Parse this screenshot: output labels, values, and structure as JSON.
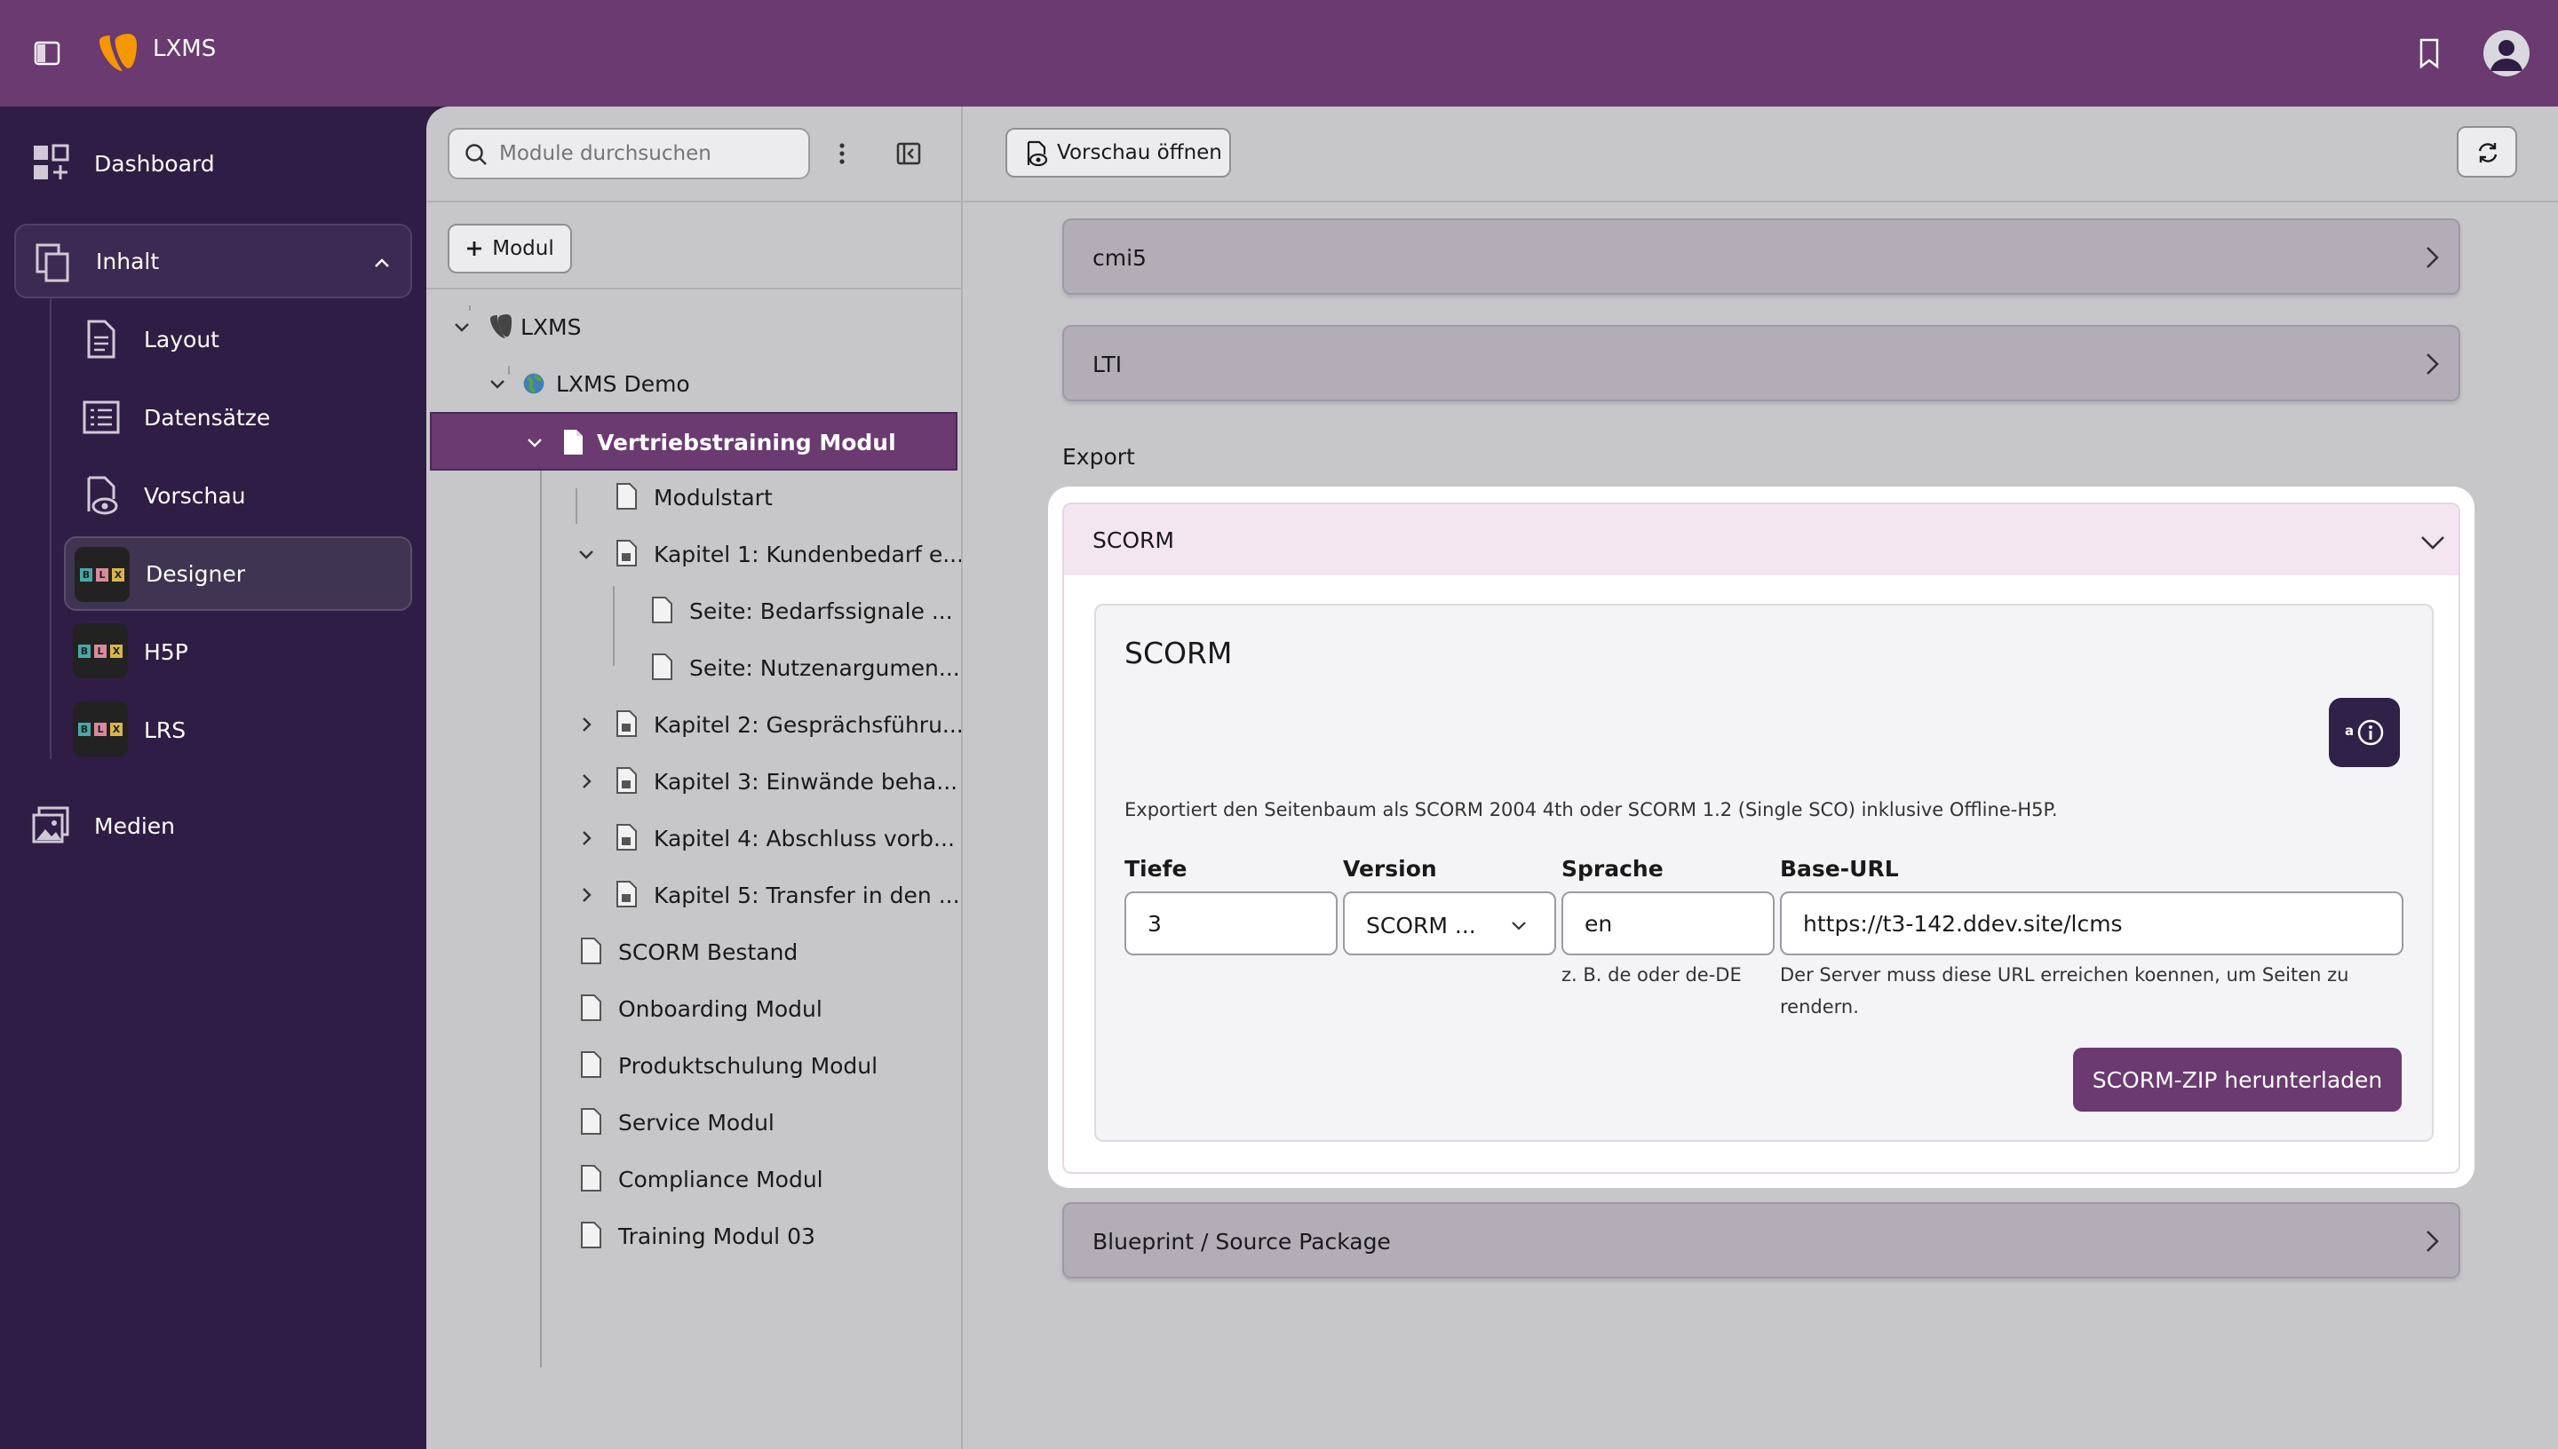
{
  "topbar": {
    "app_name": "LXMS"
  },
  "sidebar": {
    "items": [
      {
        "label": "Dashboard"
      },
      {
        "label": "Inhalt"
      },
      {
        "label": "Layout"
      },
      {
        "label": "Datensätze"
      },
      {
        "label": "Vorschau"
      },
      {
        "label": "Designer"
      },
      {
        "label": "H5P"
      },
      {
        "label": "LRS"
      },
      {
        "label": "Medien"
      }
    ],
    "blx_letters": [
      "B",
      "L",
      "X"
    ]
  },
  "tree": {
    "search_placeholder": "Module durchsuchen",
    "add_button": "Modul",
    "nodes": [
      "LXMS",
      "LXMS Demo",
      "Vertriebstraining Modul",
      "Modulstart",
      "Kapitel 1: Kundenbedarf e...",
      "Seite: Bedarfssignale ...",
      "Seite: Nutzenargumen...",
      "Kapitel 2: Gesprächsführu...",
      "Kapitel 3: Einwände beha...",
      "Kapitel 4: Abschluss vorb...",
      "Kapitel 5: Transfer in den ...",
      "SCORM Bestand",
      "Onboarding Modul",
      "Produktschulung Modul",
      "Service Modul",
      "Compliance Modul",
      "Training Modul 03"
    ]
  },
  "main": {
    "preview_button": "Vorschau öffnen",
    "sections": {
      "cmi5": "cmi5",
      "lti": "LTI",
      "blueprint": "Blueprint / Source Package"
    },
    "export_label": "Export",
    "scorm": {
      "header": "SCORM",
      "card_title": "SCORM",
      "ai_label": "a",
      "description": "Exportiert den Seitenbaum als SCORM 2004 4th oder SCORM 1.2 (Single SCO) inklusive Offline-H5P.",
      "fields": {
        "depth_label": "Tiefe",
        "depth_value": "3",
        "version_label": "Version",
        "version_value": "SCORM ...",
        "language_label": "Sprache",
        "language_value": "en",
        "language_hint": "z. B. de oder de-DE",
        "baseurl_label": "Base-URL",
        "baseurl_value": "https://t3-142.ddev.site/lcms",
        "baseurl_hint_1": "Der Server muss diese URL erreichen koennen, um Seiten zu",
        "baseurl_hint_2": "rendern."
      },
      "download_button": "SCORM-ZIP herunterladen"
    }
  },
  "colors": {
    "accent": "#6a3a71",
    "sidebar": "#2f1d45",
    "panel": "#c7c7c9",
    "ai_button": "#2f2148"
  }
}
